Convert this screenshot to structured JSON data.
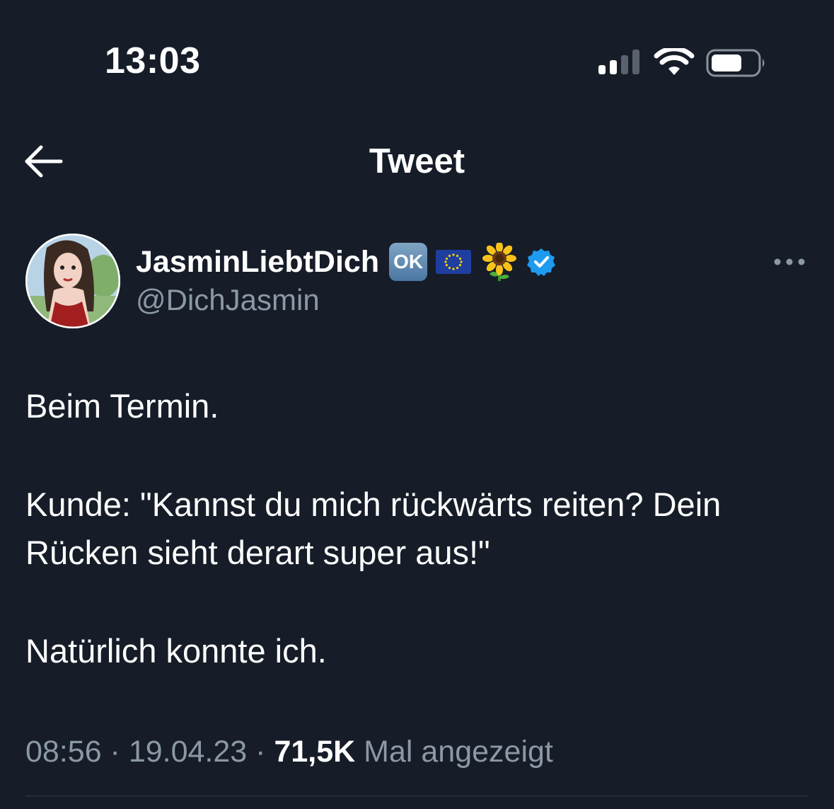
{
  "status_bar": {
    "time": "13:03",
    "signal_icon": "cellular-signal-icon",
    "wifi_icon": "wifi-icon",
    "battery_icon": "battery-icon"
  },
  "nav": {
    "back_icon": "arrow-left-icon",
    "title": "Tweet"
  },
  "tweet": {
    "author": {
      "display_name": "JasminLiebtDich",
      "handle": "@DichJasmin",
      "badges": [
        "ok-emoji",
        "eu-flag-emoji",
        "sunflower-emoji",
        "verified-badge-icon"
      ],
      "badge_ok_text": "OK",
      "avatar": "avatar"
    },
    "more_icon": "more-dots-icon",
    "text": [
      "Beim Termin.",
      "Kunde: \"Kannst du mich rückwärts reiten? Dein Rücken sieht derart super aus!\"",
      "Natürlich konnte ich."
    ],
    "meta": {
      "time": "08:56",
      "separator": " · ",
      "date": "19.04.23",
      "views_count": "71,5K",
      "views_label": "Mal angezeigt"
    }
  },
  "colors": {
    "background": "#161d28",
    "text_primary": "#ffffff",
    "text_secondary": "#8b98a5",
    "verified_blue": "#1d9bf0"
  }
}
